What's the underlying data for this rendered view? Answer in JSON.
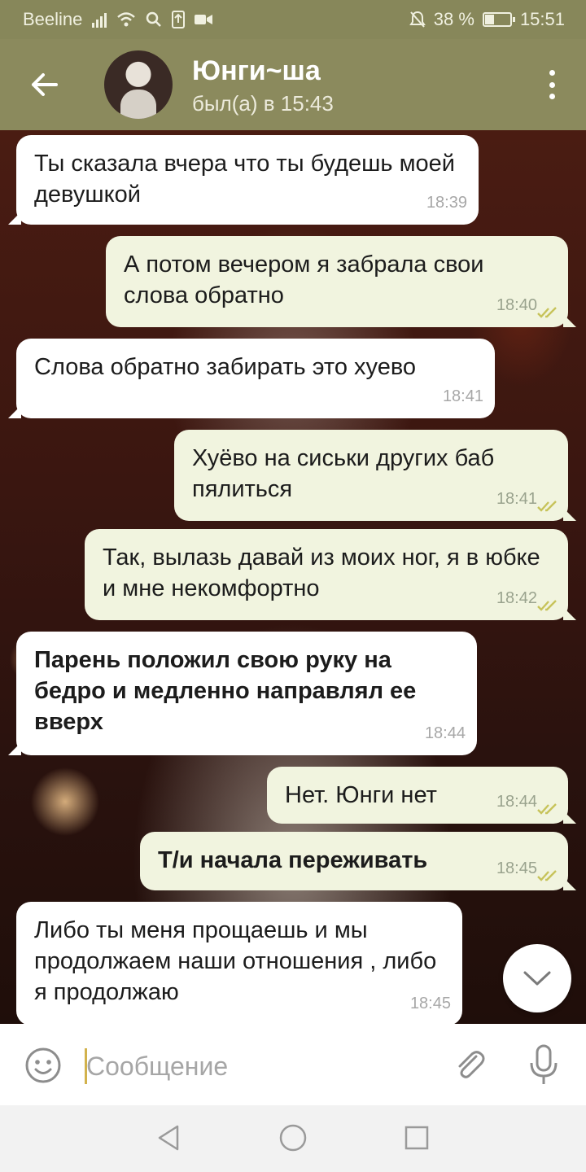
{
  "status_bar": {
    "carrier": "Beeline",
    "battery_percent": "38 %",
    "battery_level": 0.38,
    "time": "15:51",
    "icons": [
      "signal-icon",
      "wifi-icon",
      "search-icon",
      "upload-icon",
      "video-icon",
      "mute-icon",
      "battery-icon"
    ]
  },
  "header": {
    "contact_name": "Юнги~ша",
    "last_seen": "был(а) в 15:43",
    "icons": [
      "back-arrow-icon",
      "avatar",
      "more-vert-icon"
    ]
  },
  "messages": [
    {
      "direction": "in",
      "text": "Ты сказала вчера что ты будешь моей девушкой",
      "time": "18:39",
      "bold": false
    },
    {
      "direction": "out",
      "text": "А потом вечером я забрала свои слова обратно",
      "time": "18:40",
      "read": true,
      "bold": false
    },
    {
      "direction": "in",
      "text": "Слова обратно забирать это хуево",
      "time": "18:41",
      "bold": false
    },
    {
      "direction": "out",
      "text": "Хуёво на сиськи других баб пялиться",
      "time": "18:41",
      "read": true,
      "bold": false
    },
    {
      "direction": "out",
      "text": "Так, вылазь давай из моих ног, я в юбке и мне некомфортно",
      "time": "18:42",
      "read": true,
      "bold": false
    },
    {
      "direction": "in",
      "text": "Парень положил свою руку на бедро и медленно направлял ее вверх",
      "time": "18:44",
      "bold": true
    },
    {
      "direction": "out",
      "text": "Нет. Юнги нет",
      "time": "18:44",
      "read": true,
      "bold": false
    },
    {
      "direction": "out",
      "text": "Т/и начала переживать",
      "time": "18:45",
      "read": true,
      "bold": true
    },
    {
      "direction": "in",
      "text": "Либо ты меня прощаешь и мы продолжаем наши отношения , либо я продолжаю",
      "time": "18:45",
      "bold": false
    }
  ],
  "input": {
    "placeholder": "Сообщение",
    "icons": [
      "emoji-icon",
      "attach-icon",
      "mic-icon"
    ]
  },
  "colors": {
    "header_bg": "#8b8a5d",
    "statusbar_bg": "#87875a",
    "outgoing_bubble": "#f1f4df",
    "incoming_bubble": "#ffffff",
    "read_ticks": "#c7c35a",
    "cursor": "#d2b24c"
  }
}
